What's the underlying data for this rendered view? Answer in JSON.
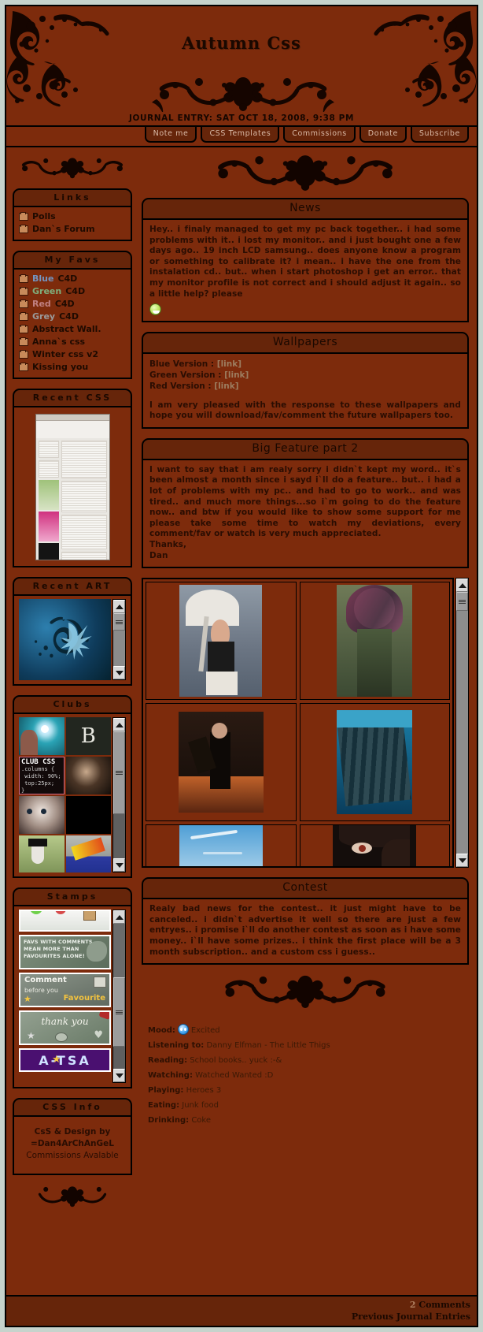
{
  "theme": {
    "bg_page": "#7d2b0c",
    "bg_panel_head": "#66250a",
    "text_dark": "#2a0d02",
    "link": "#9c7c5f",
    "outer_bg": "#c6d3cc"
  },
  "header": {
    "title": "Autumn Css",
    "journal_date": "JOURNAL ENTRY: SAT OCT 18, 2008, 9:38 PM"
  },
  "nav": {
    "items": [
      {
        "label": "Note me"
      },
      {
        "label": "CSS Templates"
      },
      {
        "label": "Commissions"
      },
      {
        "label": "Donate"
      },
      {
        "label": "Subscribe"
      }
    ]
  },
  "sidebar": {
    "links": {
      "title": "Links",
      "items": [
        {
          "label": "Polls",
          "icon": "folder-icon"
        },
        {
          "label": "Dan`s Forum",
          "icon": "folder-icon"
        }
      ]
    },
    "favs": {
      "title": "My Favs",
      "items": [
        {
          "color_word": "Blue",
          "rest": " C4D",
          "color_class": "fav-blue"
        },
        {
          "color_word": "Green",
          "rest": " C4D",
          "color_class": "fav-green"
        },
        {
          "color_word": "Red",
          "rest": " C4D",
          "color_class": "fav-red"
        },
        {
          "color_word": "Grey",
          "rest": " C4D",
          "color_class": "fav-grey"
        },
        {
          "color_word": "",
          "rest": "Abstract Wall.",
          "color_class": ""
        },
        {
          "color_word": "",
          "rest": "Anna`s css",
          "color_class": ""
        },
        {
          "color_word": "",
          "rest": "Winter css v2",
          "color_class": ""
        },
        {
          "color_word": "",
          "rest": "Kissing you",
          "color_class": ""
        }
      ]
    },
    "recent_css": {
      "title": "Recent CSS"
    },
    "recent_art": {
      "title": "Recent ART"
    },
    "clubs": {
      "title": "Clubs",
      "club_badge": "CLUB CSS"
    },
    "stamps": {
      "title": "Stamps",
      "items": [
        {
          "text": ""
        },
        {
          "text": "FAVS WITH COMMENTS MEAN MORE THAN FAVOURITES ALONE!"
        },
        {
          "text": "Comment before you Favourite"
        },
        {
          "text": "thank you"
        },
        {
          "text": "A-TSA"
        }
      ]
    },
    "css_info": {
      "title": "CSS Info",
      "line1": "CsS & Design by",
      "line2": "=Dan4ArChAnGeL",
      "line3": "Commissions Avalable"
    }
  },
  "main": {
    "news": {
      "title": "News",
      "body": "Hey.. i finaly managed to get my pc back together.. i had some problems with it.. i lost my monitor.. and i just bought one a few days ago.. 19 inch LCD samsung.. does anyone know a program or something to calibrate it? i mean.. i have the one from the instalation cd.. but.. when i start photoshop i get an error.. that my monitor profile is not correct and i should adjust it again.. so a little help? please"
    },
    "wallpapers": {
      "title": "Wallpapers",
      "rows": [
        {
          "label": "Blue Version : ",
          "link": "[link]"
        },
        {
          "label": "Green Version : ",
          "link": "[link]"
        },
        {
          "label": "Red Version : ",
          "link": "[link]"
        }
      ],
      "body": "I am very pleased with the response to these wallpapers and hope you will download/fav/comment the future wallpapers too."
    },
    "big_feature": {
      "title": "Big Feature part 2",
      "body": "I want to say that i am realy sorry i didn`t kept my word.. it`s been almost a month since i sayd i`ll do a feature.. but.. i had a lot of problems with my pc.. and had to go to work.. and was tired.. and much more things...so i`m going to do the feature now.. and btw if you would like to show some support for me please take some time to watch my deviations, every comment/fav or watch is very much appreciated.",
      "sign_line1": "Thanks,",
      "sign_line2": "Dan"
    },
    "contest": {
      "title": "Contest",
      "body": "Realy bad news for the contest.. it just might have to be canceled.. i didn`t advertise it well so there are just a few entryes.. i promise i`ll do another contest as soon as i have some money.. i`ll have some prizes.. i think the first place will be a 3 month subscription.. and a custom css i guess.."
    },
    "meta": [
      {
        "label": "Mood:",
        "value": "Excited",
        "has_emote": true
      },
      {
        "label": "Listening to:",
        "value": "Danny Elfman - The Little Thigs",
        "has_emote": false
      },
      {
        "label": "Reading:",
        "value": "School books.. yuck :-&",
        "has_emote": false
      },
      {
        "label": "Watching:",
        "value": "Watched Wanted :D",
        "has_emote": false
      },
      {
        "label": "Playing:",
        "value": "Heroes 3",
        "has_emote": false
      },
      {
        "label": "Eating:",
        "value": "Junk food",
        "has_emote": false
      },
      {
        "label": "Drinking:",
        "value": "Coke",
        "has_emote": false
      }
    ]
  },
  "footer": {
    "comments_count": "2",
    "comments_label": " Comments",
    "previous_label": "Previous Journal Entries"
  }
}
